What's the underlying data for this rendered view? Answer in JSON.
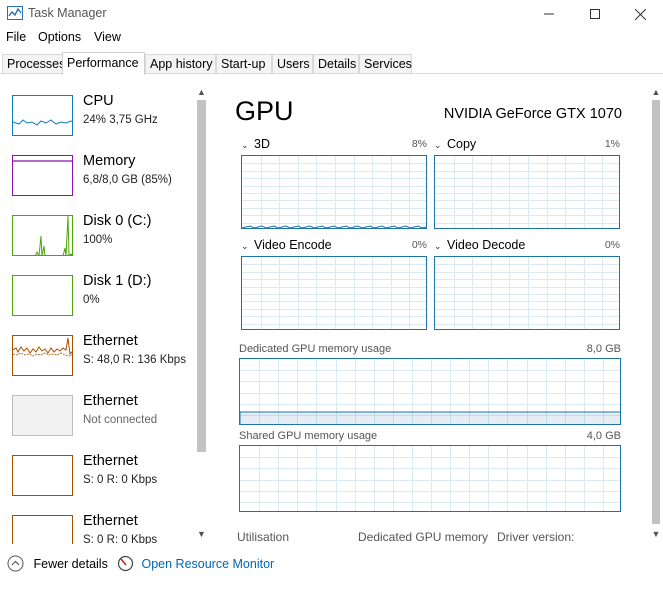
{
  "window": {
    "title": "Task Manager"
  },
  "menu": {
    "file": "File",
    "options": "Options",
    "view": "View"
  },
  "tabs": {
    "processes": "Processes",
    "performance": "Performance",
    "app_history": "App history",
    "startup": "Start-up",
    "users": "Users",
    "details": "Details",
    "services": "Services"
  },
  "sidebar": {
    "items": [
      {
        "name": "CPU",
        "sub": "24%  3,75 GHz",
        "color": "#117dbb"
      },
      {
        "name": "Memory",
        "sub": "6,8/8,0 GB (85%)",
        "color": "#8b12ae"
      },
      {
        "name": "Disk 0 (C:)",
        "sub": "100%",
        "color": "#4da60c"
      },
      {
        "name": "Disk 1 (D:)",
        "sub": "0%",
        "color": "#4da60c"
      },
      {
        "name": "Ethernet",
        "sub_s": "S: 48,0",
        "sub_r": "R: 136 Kbps",
        "color": "#a74f01"
      },
      {
        "name": "Ethernet",
        "sub": "Not connected",
        "color": "#bcbcbc"
      },
      {
        "name": "Ethernet",
        "sub_s": "S: 0",
        "sub_r": "R: 0 Kbps",
        "color": "#a74f01"
      },
      {
        "name": "Ethernet",
        "sub_s": "S: 0",
        "sub_r": "R: 0 Kbps",
        "color": "#a74f01"
      }
    ]
  },
  "gpu": {
    "title": "GPU",
    "model": "NVIDIA GeForce GTX 1070",
    "color": "#1e74a8",
    "engines": [
      {
        "name": "3D",
        "pct": "8%"
      },
      {
        "name": "Copy",
        "pct": "1%"
      },
      {
        "name": "Video Encode",
        "pct": "0%"
      },
      {
        "name": "Video Decode",
        "pct": "0%"
      }
    ],
    "dedicated": {
      "label": "Dedicated GPU memory usage",
      "max": "8,0 GB"
    },
    "shared": {
      "label": "Shared GPU memory usage",
      "max": "4,0 GB"
    },
    "stats": {
      "utilisation": "Utilisation",
      "dedicated_memory": "Dedicated GPU memory",
      "driver_version": "Driver version:"
    }
  },
  "footer": {
    "fewer_details": "Fewer details",
    "open_resource_monitor": "Open Resource Monitor"
  }
}
